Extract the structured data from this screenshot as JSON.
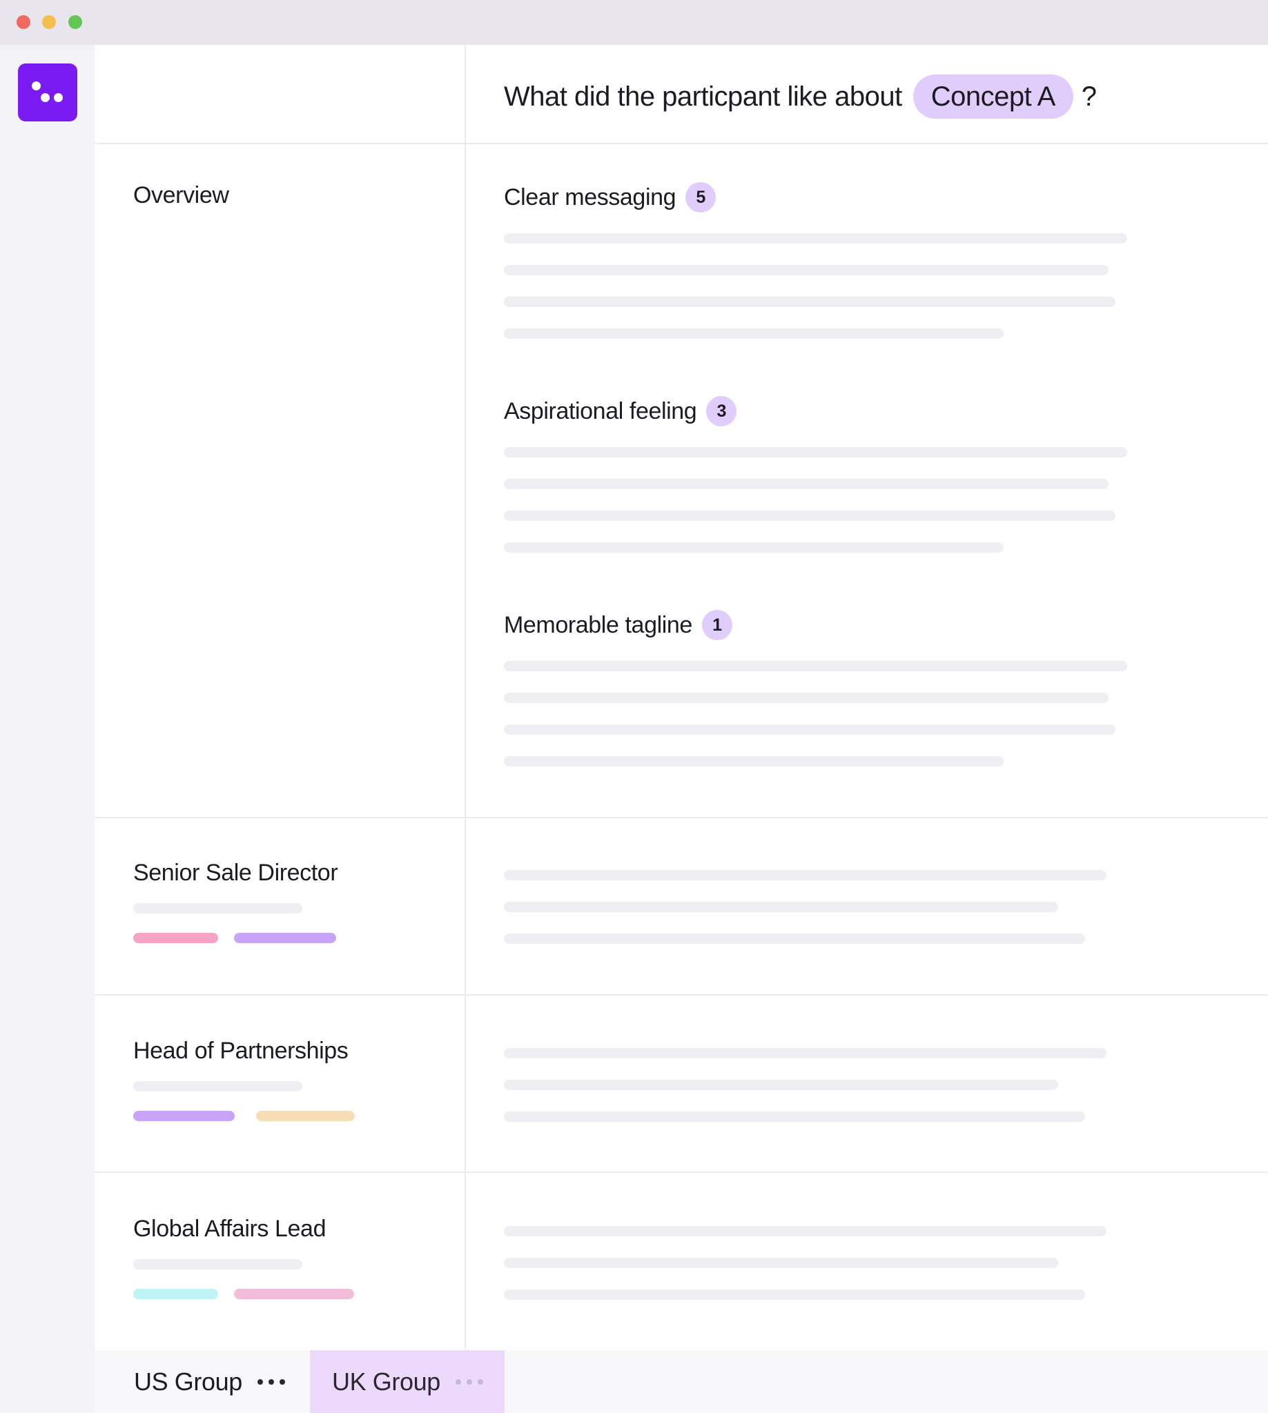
{
  "window": {
    "controls": [
      "close",
      "minimize",
      "maximize"
    ]
  },
  "rail": {
    "logo_icon": "app-logo-icon",
    "logo_color": "#7a1bf2"
  },
  "question": {
    "prefix": "What did the particpant like about",
    "concept": "Concept A",
    "suffix": "?"
  },
  "overview": {
    "label": "Overview",
    "themes": [
      {
        "title": "Clear messaging",
        "count": "5"
      },
      {
        "title": "Aspirational feeling",
        "count": "3"
      },
      {
        "title": "Memorable tagline",
        "count": "1"
      }
    ]
  },
  "participants": [
    {
      "role": "Senior Sale Director",
      "tag_colors": [
        "#f7a3c5",
        "#c9a3f6"
      ]
    },
    {
      "role": "Head of Partnerships",
      "tag_colors": [
        "#c9a3f6",
        "#f6ddb5"
      ]
    },
    {
      "role": "Global Affairs Lead",
      "tag_colors": [
        "#bff4f6",
        "#f1bdd8"
      ]
    }
  ],
  "tabs": [
    {
      "label": "US Group",
      "active": false,
      "more_icon": "more-horizontal-icon"
    },
    {
      "label": "UK Group",
      "active": true,
      "more_icon": "more-horizontal-icon"
    }
  ],
  "colors": {
    "accent": "#7a1bf2",
    "pill": "#e1cdfb",
    "skeleton": "#efeef2",
    "active_tab": "#ecd9fb"
  }
}
